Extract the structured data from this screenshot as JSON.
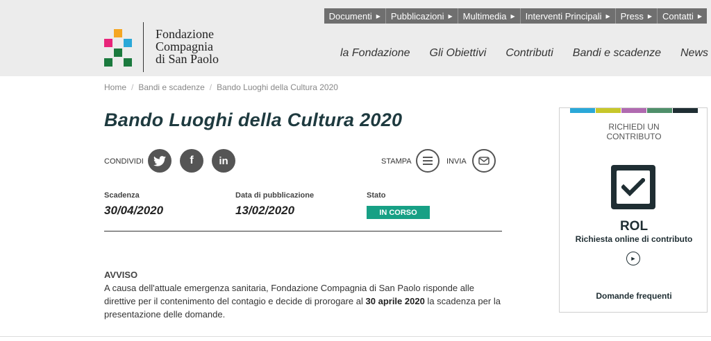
{
  "topnav": [
    {
      "label": "Documenti"
    },
    {
      "label": "Pubblicazioni"
    },
    {
      "label": "Multimedia"
    },
    {
      "label": "Interventi Principali"
    },
    {
      "label": "Press"
    },
    {
      "label": "Contatti"
    }
  ],
  "logo": {
    "line1": "Fondazione",
    "line2": "Compagnia",
    "line3": "di San Paolo",
    "colors": [
      "#f5a623",
      "#e8257a",
      "#2aa8d8",
      "#1b7a3e"
    ]
  },
  "mainnav": [
    {
      "label": "la Fondazione"
    },
    {
      "label": "Gli Obiettivi"
    },
    {
      "label": "Contributi"
    },
    {
      "label": "Bandi e scadenze"
    },
    {
      "label": "News"
    }
  ],
  "breadcrumb": {
    "home": "Home",
    "section": "Bandi e scadenze",
    "current": "Bando Luoghi della Cultura 2020",
    "separator": "/"
  },
  "page": {
    "title": "Bando Luoghi della Cultura 2020"
  },
  "share": {
    "label": "CONDIVIDI",
    "twitter_icon": "twitter-icon",
    "facebook_icon": "facebook-icon",
    "linkedin_icon": "linkedin-icon",
    "print_label": "STAMPA",
    "send_label": "INVIA"
  },
  "meta": {
    "deadline_label": "Scadenza",
    "deadline_value": "30/04/2020",
    "published_label": "Data di pubblicazione",
    "published_value": "13/02/2020",
    "status_label": "Stato",
    "status_value": "IN CORSO",
    "status_color": "#17a085"
  },
  "notice": {
    "title": "AVVISO",
    "text_before": "A causa dell'attuale emergenza sanitaria, Fondazione Compagnia di San Paolo risponde alle direttive per il contenimento del contagio e decide di prorogare al ",
    "text_bold": "30 aprile 2020",
    "text_after": " la scadenza per la presentazione delle domande."
  },
  "sidebox": {
    "colors": [
      "#2aa8d8",
      "#c7c72a",
      "#b06ab0",
      "#4f8f6a",
      "#1f2e33"
    ],
    "head_line1": "RICHIEDI UN",
    "head_line2": "CONTRIBUTO",
    "icon": "checkbox-icon",
    "rol_title": "ROL",
    "rol_subtitle": "Richiesta online di contributo",
    "arrow_icon": "arrow-right-icon",
    "faq": "Domande frequenti"
  }
}
